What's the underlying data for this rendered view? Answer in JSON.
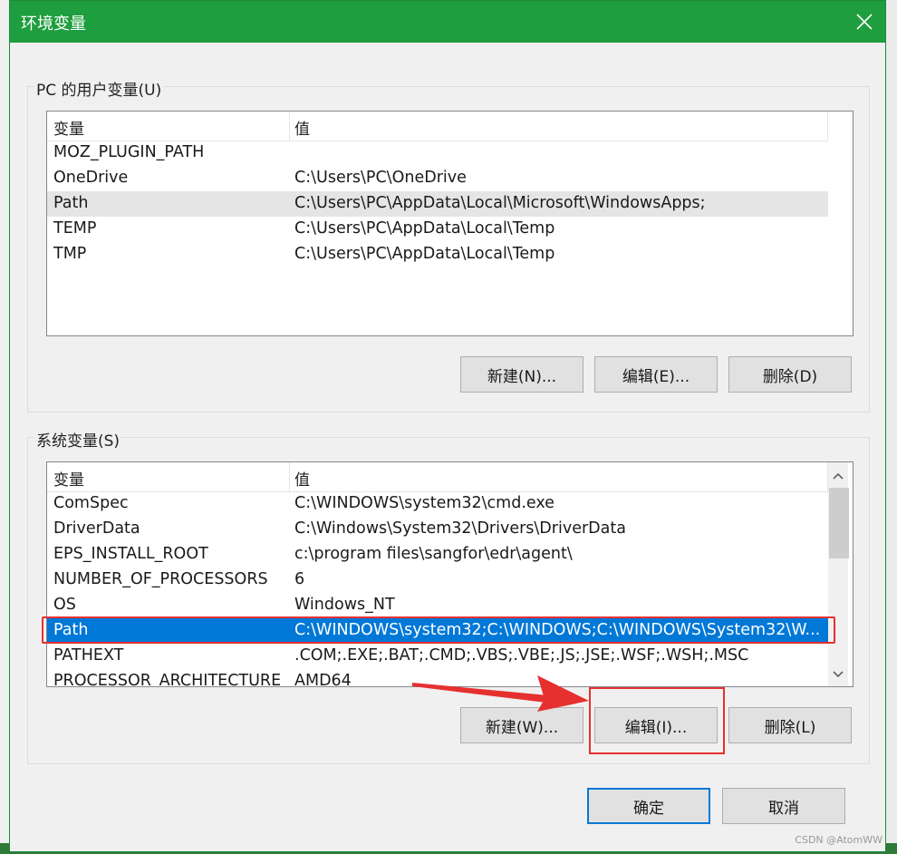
{
  "dialog": {
    "title": "环境变量",
    "close_icon": "close-icon"
  },
  "user_vars": {
    "group_label": "PC 的用户变量(U)",
    "headers": {
      "name": "变量",
      "value": "值"
    },
    "rows": [
      {
        "name": "MOZ_PLUGIN_PATH",
        "value": ""
      },
      {
        "name": "OneDrive",
        "value": "C:\\Users\\PC\\OneDrive"
      },
      {
        "name": "Path",
        "value": "C:\\Users\\PC\\AppData\\Local\\Microsoft\\WindowsApps;"
      },
      {
        "name": "TEMP",
        "value": "C:\\Users\\PC\\AppData\\Local\\Temp"
      },
      {
        "name": "TMP",
        "value": "C:\\Users\\PC\\AppData\\Local\\Temp"
      }
    ],
    "highlighted_row": "Path",
    "buttons": {
      "new": "新建(N)...",
      "edit": "编辑(E)...",
      "delete": "删除(D)"
    }
  },
  "system_vars": {
    "group_label": "系统变量(S)",
    "headers": {
      "name": "变量",
      "value": "值"
    },
    "rows": [
      {
        "name": "ComSpec",
        "value": "C:\\WINDOWS\\system32\\cmd.exe"
      },
      {
        "name": "DriverData",
        "value": "C:\\Windows\\System32\\Drivers\\DriverData"
      },
      {
        "name": "EPS_INSTALL_ROOT",
        "value": "c:\\program files\\sangfor\\edr\\agent\\"
      },
      {
        "name": "NUMBER_OF_PROCESSORS",
        "value": "6"
      },
      {
        "name": "OS",
        "value": "Windows_NT"
      },
      {
        "name": "Path",
        "value": "C:\\WINDOWS\\system32;C:\\WINDOWS;C:\\WINDOWS\\System32\\W..."
      },
      {
        "name": "PATHEXT",
        "value": ".COM;.EXE;.BAT;.CMD;.VBS;.VBE;.JS;.JSE;.WSF;.WSH;.MSC"
      },
      {
        "name": "PROCESSOR_ARCHITECTURE",
        "value": "AMD64"
      }
    ],
    "selected_row": "Path",
    "scroll_up_icon": "chevron-up-icon",
    "scroll_down_icon": "chevron-down-icon",
    "buttons": {
      "new": "新建(W)...",
      "edit": "编辑(I)...",
      "delete": "删除(L)"
    }
  },
  "footer": {
    "ok": "确定",
    "cancel": "取消"
  },
  "annotation": {
    "arrow_icon": "arrow-right-icon",
    "color": "#e63030"
  },
  "watermark": "CSDN @AtomWW"
}
